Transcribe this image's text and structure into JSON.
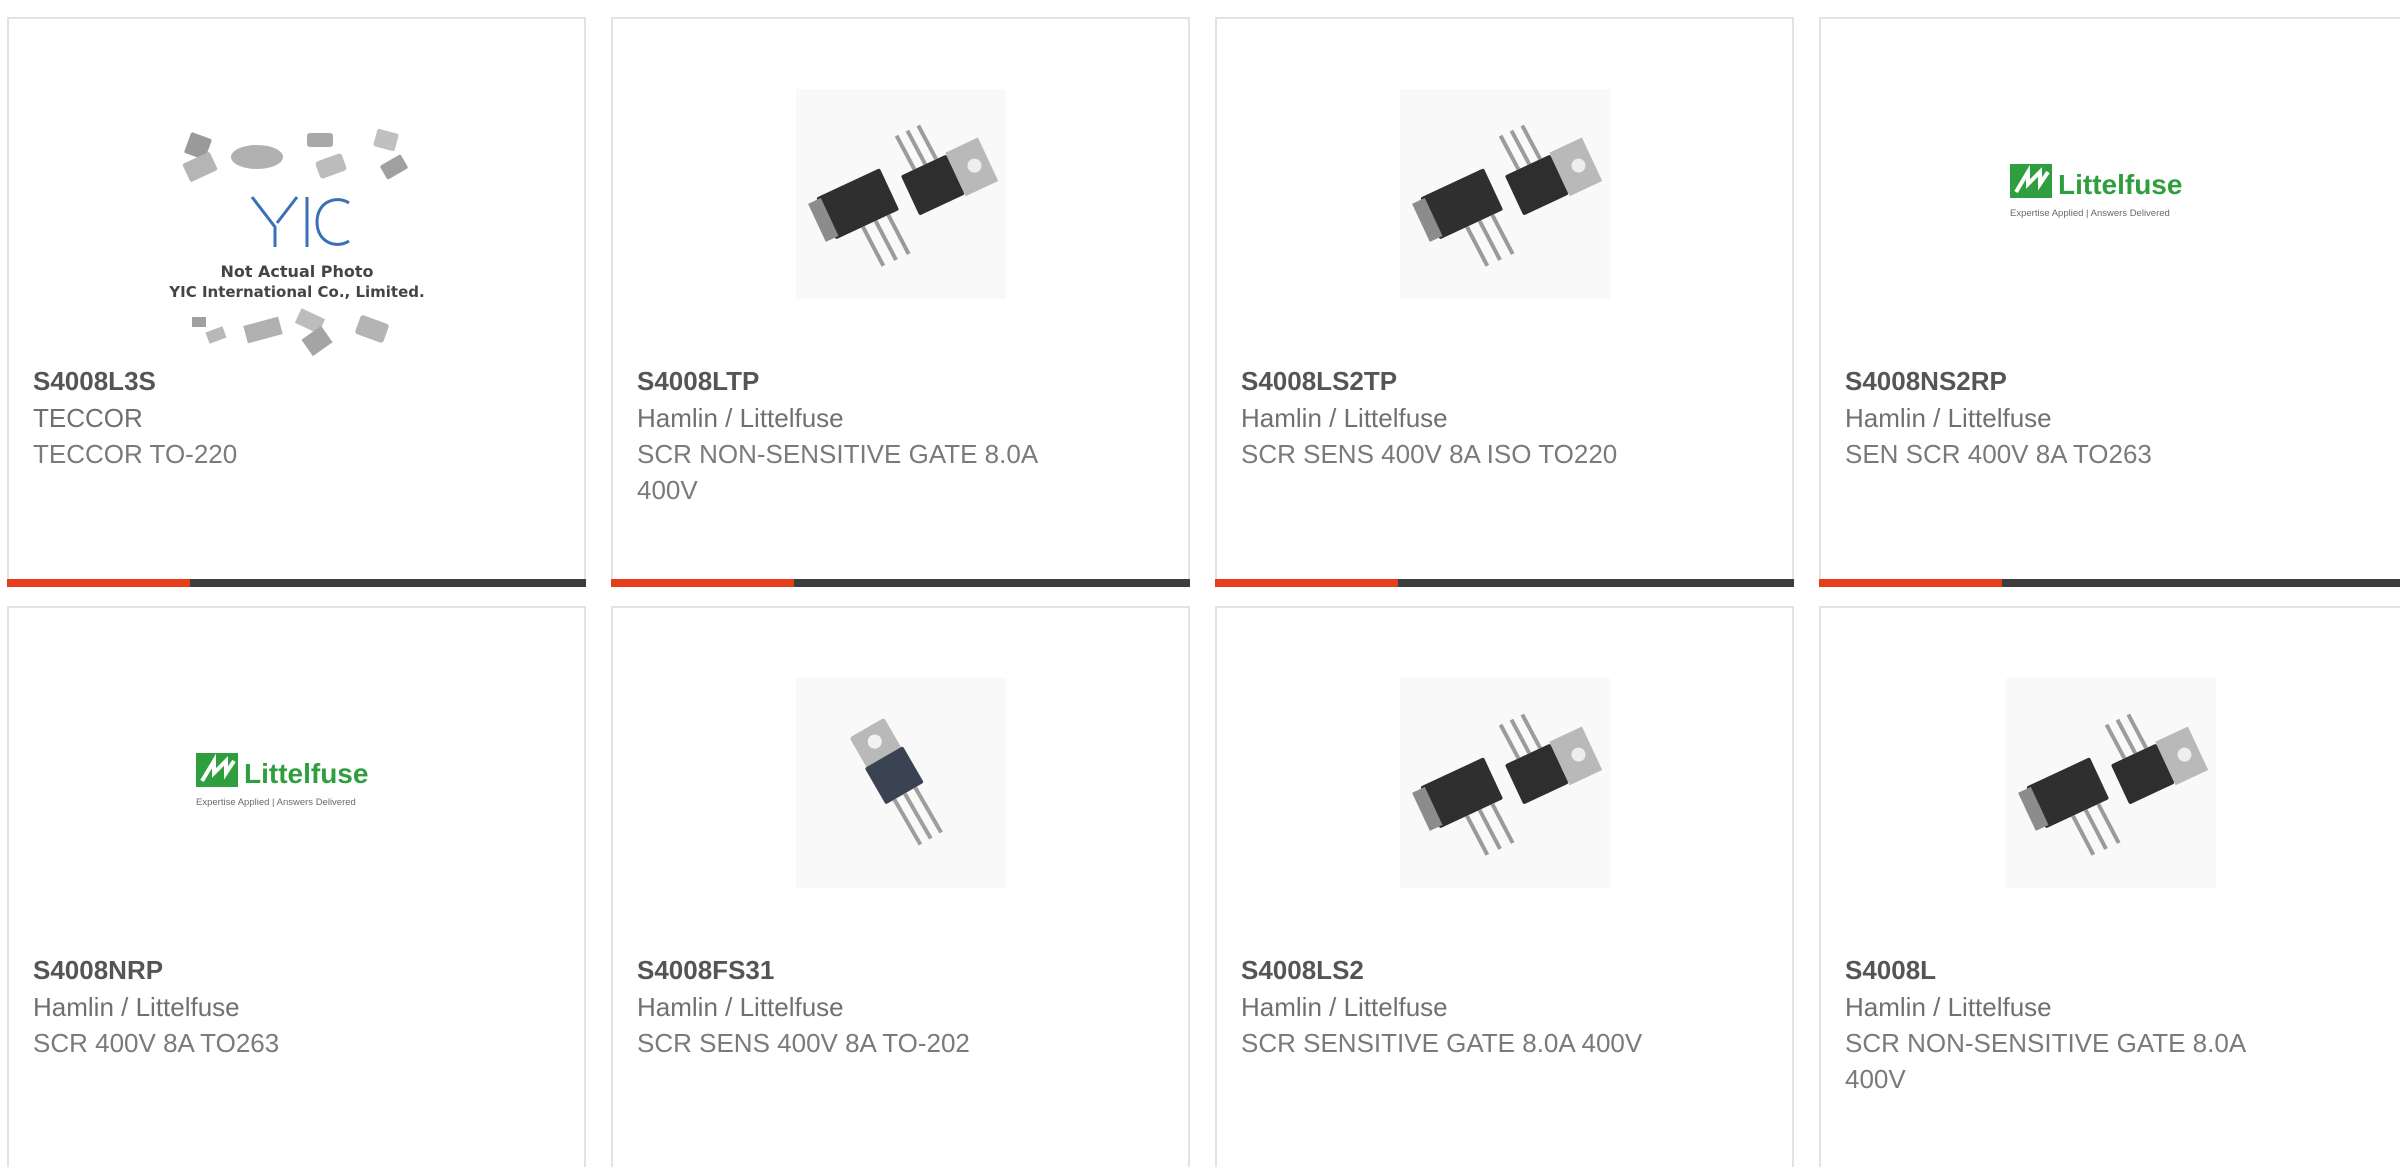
{
  "colors": {
    "accent": "#e43e1b",
    "bar": "#3d3d3d",
    "brand_green": "#2f9e3f"
  },
  "cards": [
    {
      "part_number": "S4008L3S",
      "manufacturer": "TECCOR",
      "description": "TECCOR TO-220",
      "image": "yic-not-actual-photo",
      "yic_line1": "Not Actual Photo",
      "yic_line2": "YIC International Co., Limited."
    },
    {
      "part_number": "S4008LTP",
      "manufacturer": "Hamlin / Littelfuse",
      "description": "SCR NON-SENSITIVE GATE 8.0A 400V",
      "image": "to220-pair-photo"
    },
    {
      "part_number": "S4008LS2TP",
      "manufacturer": "Hamlin / Littelfuse",
      "description": "SCR SENS 400V 8A ISO TO220",
      "image": "to220-pair-photo"
    },
    {
      "part_number": "S4008NS2RP",
      "manufacturer": "Hamlin / Littelfuse",
      "description": "SEN SCR 400V 8A TO263",
      "image": "littelfuse-logo",
      "logo_text": "Littelfuse",
      "logo_tagline": "Expertise Applied | Answers Delivered"
    },
    {
      "part_number": "S4008NRP",
      "manufacturer": "Hamlin / Littelfuse",
      "description": "SCR 400V 8A TO263",
      "image": "littelfuse-logo",
      "logo_text": "Littelfuse",
      "logo_tagline": "Expertise Applied | Answers Delivered"
    },
    {
      "part_number": "S4008FS31",
      "manufacturer": "Hamlin / Littelfuse",
      "description": "SCR SENS 400V 8A TO-202",
      "image": "to202-photo"
    },
    {
      "part_number": "S4008LS2",
      "manufacturer": "Hamlin / Littelfuse",
      "description": "SCR SENSITIVE GATE 8.0A 400V",
      "image": "to220-pair-photo"
    },
    {
      "part_number": "S4008L",
      "manufacturer": "Hamlin / Littelfuse",
      "description": "SCR NON-SENSITIVE GATE 8.0A 400V",
      "image": "to220-pair-photo"
    }
  ]
}
